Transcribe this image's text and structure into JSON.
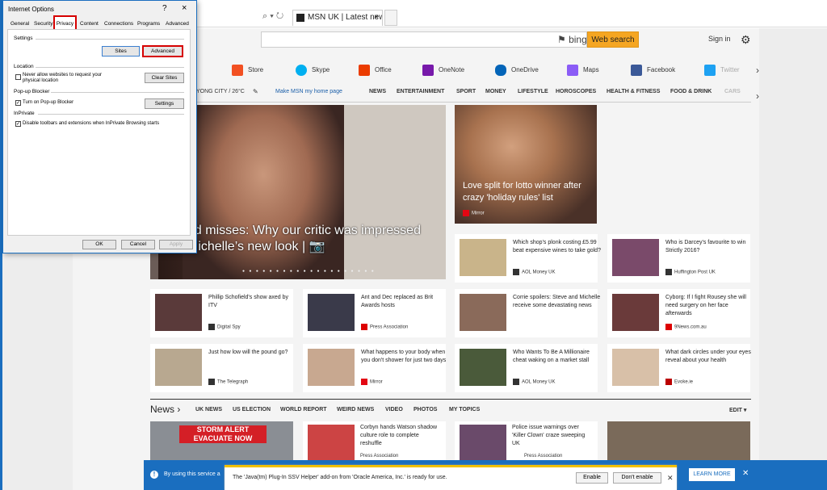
{
  "browser": {
    "address_text": "",
    "tab_label": "MSN UK | Latest news, Hot...",
    "tab_close": "×"
  },
  "msn": {
    "bing_label": "bing",
    "web_search_label": "Web search",
    "sign_in_label": "Sign in",
    "apps": [
      {
        "label": "Store",
        "color": "#f25022"
      },
      {
        "label": "Skype",
        "color": "#00aff0"
      },
      {
        "label": "Office",
        "color": "#eb3c00"
      },
      {
        "label": "OneNote",
        "color": "#7719aa"
      },
      {
        "label": "OneDrive",
        "color": "#0364b8"
      },
      {
        "label": "Maps",
        "color": "#8b5cf6"
      },
      {
        "label": "Facebook",
        "color": "#3b5998"
      },
      {
        "label": "Twitter",
        "color": "#1da1f2"
      }
    ],
    "weather": "YONG CITY / 26°C",
    "make_my_home": "Make MSN my home page",
    "nav": [
      "NEWS",
      "ENTERTAINMENT",
      "SPORT",
      "MONEY",
      "LIFESTYLE",
      "HOROSCOPES",
      "HEALTH & FITNESS",
      "FOOD & DRINK",
      "CARS"
    ],
    "hero_title": "nd misses: Why our critic was impressed Michelle’s new look |",
    "hero2_title": "Love split for lotto winner after crazy 'holiday rules' list",
    "hero2_source": "Mirror",
    "cards": [
      {
        "title": "Which shop's plonk costing £5.99 beat expensive wines to take gold?",
        "source": "AOL Money UK",
        "thumb": "#c9b48a"
      },
      {
        "title": "Who is Darcey's favourite to win Strictly 2016?",
        "source": "Huffington Post UK",
        "thumb": "#7a4a6a"
      },
      {
        "title": "Phillip Schofield's show axed by ITV",
        "source": "Digital Spy",
        "thumb": "#5a3a3a"
      },
      {
        "title": "Ant and Dec replaced as Brit Awards hosts",
        "source": "Press Association",
        "thumb": "#3a3a4a"
      },
      {
        "title": "Corrie spoilers: Steve and Michelle receive some devastating news",
        "source": "",
        "thumb": "#8a6a5a"
      },
      {
        "title": "Cyborg: If I fight Rousey she will need surgery on her face afterwards",
        "source": "9News.com.au",
        "thumb": "#6a3a3a"
      },
      {
        "title": "Just how low will the pound go?",
        "source": "The Telegraph",
        "thumb": "#b8a890"
      },
      {
        "title": "What happens to your body when you don't shower for just two days",
        "source": "Mirror",
        "thumb": "#c8a890"
      },
      {
        "title": "Who Wants To Be A Millionaire cheat waking on a market stall",
        "source": "AOL Money UK",
        "thumb": "#4a5a3a"
      },
      {
        "title": "What dark circles under your eyes reveal about your health",
        "source": "Evoke.ie",
        "thumb": "#d8c0a8"
      }
    ],
    "news_heading": "News",
    "news_links": [
      "UK NEWS",
      "US ELECTION",
      "WORLD REPORT",
      "WEIRD NEWS",
      "VIDEO",
      "PHOTOS",
      "MY TOPICS"
    ],
    "edit_label": "EDIT",
    "news_items": [
      {
        "title": "STORM ALERT EVACUATE NOW",
        "source": ""
      },
      {
        "title": "Corbyn hands Watson shadow culture role to complete reshuffle",
        "source": "Press Association"
      },
      {
        "title": "Police issue warnings over 'Killer Clown' craze sweeping UK",
        "source": "Press Association"
      }
    ],
    "privacy_bar_text": "By using this service a",
    "learn_more": "LEARN MORE",
    "notification_text": "The 'Java(tm) Plug-In SSV Helper' add-on from 'Oracle America, Inc.' is ready for use.",
    "enable_label": "Enable",
    "dont_enable_label": "Don't enable"
  },
  "dialog": {
    "title": "Internet Options",
    "help": "?",
    "close": "×",
    "tabs": [
      "General",
      "Security",
      "Privacy",
      "Content",
      "Connections",
      "Programs",
      "Advanced"
    ],
    "settings_heading": "Settings",
    "sites_label": "Sites",
    "advanced_label": "Advanced",
    "location_heading": "Location",
    "location_checkbox": "Never allow websites to request your physical location",
    "clear_sites_label": "Clear Sites",
    "popup_heading": "Pop-up Blocker",
    "popup_checkbox": "Turn on Pop-up Blocker",
    "settings_btn": "Settings",
    "inprivate_heading": "InPrivate",
    "inprivate_checkbox": "Disable toolbars and extensions when InPrivate Browsing starts",
    "ok": "OK",
    "cancel": "Cancel",
    "apply": "Apply",
    "check": "✓"
  }
}
